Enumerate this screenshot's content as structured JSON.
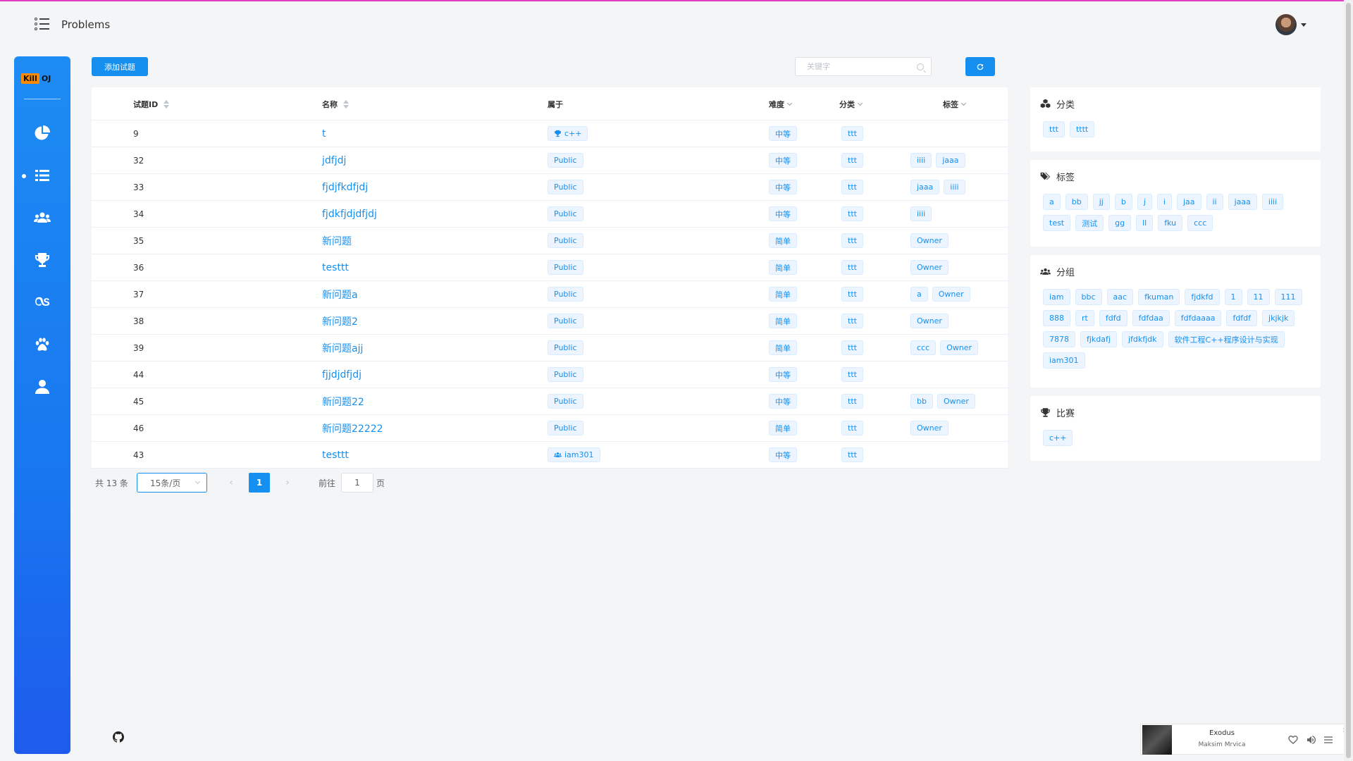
{
  "header": {
    "title": "Problems"
  },
  "sidebar": {
    "logo": {
      "kill": "Kill",
      "oj": "OJ"
    },
    "items": [
      {
        "icon": "pie-chart-icon"
      },
      {
        "icon": "list-icon",
        "active": true
      },
      {
        "icon": "users-icon"
      },
      {
        "icon": "trophy-icon"
      },
      {
        "icon": "lastfm-icon"
      },
      {
        "icon": "paw-icon"
      },
      {
        "icon": "user-icon"
      }
    ]
  },
  "toolbar": {
    "add_label": "添加试题",
    "search_placeholder": "关键字"
  },
  "table": {
    "headers": {
      "id": "试题ID",
      "name": "名称",
      "belong": "属于",
      "difficulty": "难度",
      "category": "分类",
      "tags": "标签"
    },
    "rows": [
      {
        "id": "9",
        "name": "t",
        "belong": {
          "text": "c++",
          "icon": "trophy"
        },
        "difficulty": "中等",
        "category": "ttt",
        "tags": []
      },
      {
        "id": "32",
        "name": "jdfjdj",
        "belong": {
          "text": "Public"
        },
        "difficulty": "中等",
        "category": "ttt",
        "tags": [
          "iiii",
          "jaaa"
        ]
      },
      {
        "id": "33",
        "name": "fjdjfkdfjdj",
        "belong": {
          "text": "Public"
        },
        "difficulty": "中等",
        "category": "ttt",
        "tags": [
          "jaaa",
          "iiii"
        ]
      },
      {
        "id": "34",
        "name": "fjdkfjdjdfjdj",
        "belong": {
          "text": "Public"
        },
        "difficulty": "中等",
        "category": "ttt",
        "tags": [
          "iiii"
        ]
      },
      {
        "id": "35",
        "name": "新问题",
        "belong": {
          "text": "Public"
        },
        "difficulty": "简单",
        "category": "ttt",
        "tags": [
          "Owner"
        ]
      },
      {
        "id": "36",
        "name": "testtt",
        "belong": {
          "text": "Public"
        },
        "difficulty": "简单",
        "category": "ttt",
        "tags": [
          "Owner"
        ]
      },
      {
        "id": "37",
        "name": "新问题a",
        "belong": {
          "text": "Public"
        },
        "difficulty": "简单",
        "category": "ttt",
        "tags": [
          "a",
          "Owner"
        ]
      },
      {
        "id": "38",
        "name": "新问题2",
        "belong": {
          "text": "Public"
        },
        "difficulty": "简单",
        "category": "ttt",
        "tags": [
          "Owner"
        ]
      },
      {
        "id": "39",
        "name": "新问题ajj",
        "belong": {
          "text": "Public"
        },
        "difficulty": "简单",
        "category": "ttt",
        "tags": [
          "ccc",
          "Owner"
        ]
      },
      {
        "id": "44",
        "name": "fjjdjdfjdj",
        "belong": {
          "text": "Public"
        },
        "difficulty": "中等",
        "category": "ttt",
        "tags": []
      },
      {
        "id": "45",
        "name": "新问题22",
        "belong": {
          "text": "Public"
        },
        "difficulty": "中等",
        "category": "ttt",
        "tags": [
          "bb",
          "Owner"
        ]
      },
      {
        "id": "46",
        "name": "新问题22222",
        "belong": {
          "text": "Public"
        },
        "difficulty": "简单",
        "category": "ttt",
        "tags": [
          "Owner"
        ]
      },
      {
        "id": "43",
        "name": "testtt",
        "belong": {
          "text": "iam301",
          "icon": "users"
        },
        "difficulty": "中等",
        "category": "ttt",
        "tags": []
      }
    ]
  },
  "pagination": {
    "total": "共 13 条",
    "page_size": "15条/页",
    "current": "1",
    "goto_label": "前往",
    "goto_value": "1",
    "goto_suffix": "页",
    "prev": "‹",
    "next": "›"
  },
  "panels": [
    {
      "key": "category",
      "title": "分类",
      "icon": "cubes-icon",
      "tags": [
        "ttt",
        "tttt"
      ]
    },
    {
      "key": "tags",
      "title": "标签",
      "icon": "tags-icon",
      "tags": [
        "a",
        "bb",
        "jj",
        "b",
        "j",
        "i",
        "jaa",
        "ii",
        "jaaa",
        "iiii",
        "test",
        "测试",
        "gg",
        "ll",
        "fku",
        "ccc"
      ]
    },
    {
      "key": "groups",
      "title": "分组",
      "icon": "users-icon",
      "tags": [
        "iam",
        "bbc",
        "aac",
        "fkuman",
        "fjdkfd",
        "1",
        "11",
        "111",
        "888",
        "rt",
        "fdfd",
        "fdfdaa",
        "fdfdaaaa",
        "fdfdf",
        "jkjkjk",
        "7878",
        "fjkdafj",
        "jfdkfjdk",
        "软件工程C++程序设计与实现",
        "iam301"
      ]
    },
    {
      "key": "contests",
      "title": "比赛",
      "icon": "trophy-icon",
      "tags": [
        "c++"
      ]
    }
  ],
  "player": {
    "song": "Exodus",
    "artist": "Maksim Mrvica",
    "close": "×"
  },
  "colors": {
    "primary": "#1590f0",
    "accent_top": "#e040c8",
    "logo_badge": "#ff8a00"
  }
}
